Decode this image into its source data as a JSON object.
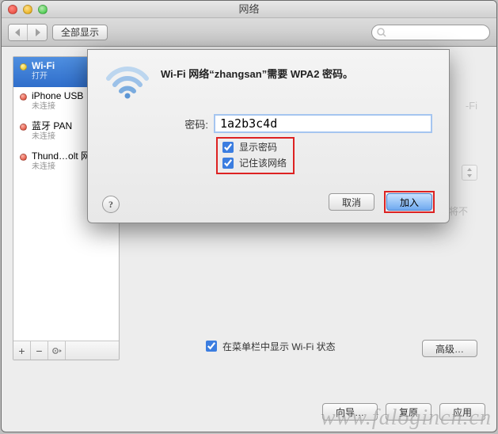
{
  "window": {
    "title": "网络",
    "show_all": "全部显示",
    "search_placeholder": ""
  },
  "sidebar": {
    "items": [
      {
        "name": "Wi-Fi",
        "status_label": "打开",
        "dot": "yellow",
        "selected": true
      },
      {
        "name": "iPhone USB",
        "status_label": "未连接",
        "dot": "red",
        "selected": false
      },
      {
        "name": "蓝牙 PAN",
        "status_label": "未连接",
        "dot": "red",
        "selected": false
      },
      {
        "name": "Thund…olt 网桥",
        "status_label": "未连接",
        "dot": "red",
        "selected": false
      }
    ]
  },
  "main": {
    "status_right": "-Fi",
    "hint_right": "。您将不",
    "menubar_checkbox_label": "在菜单栏中显示 Wi-Fi 状态",
    "advanced": "高级…"
  },
  "footer": {
    "wizard": "向导…",
    "revert": "复原",
    "apply": "应用"
  },
  "dialog": {
    "title": "Wi-Fi 网络“zhangsan”需要 WPA2 密码。",
    "password_label": "密码:",
    "password_value": "1a2b3c4d",
    "show_password_label": "显示密码",
    "remember_label": "记住该网络",
    "cancel": "取消",
    "join": "加入"
  },
  "watermark": "www.falogincn.cn"
}
